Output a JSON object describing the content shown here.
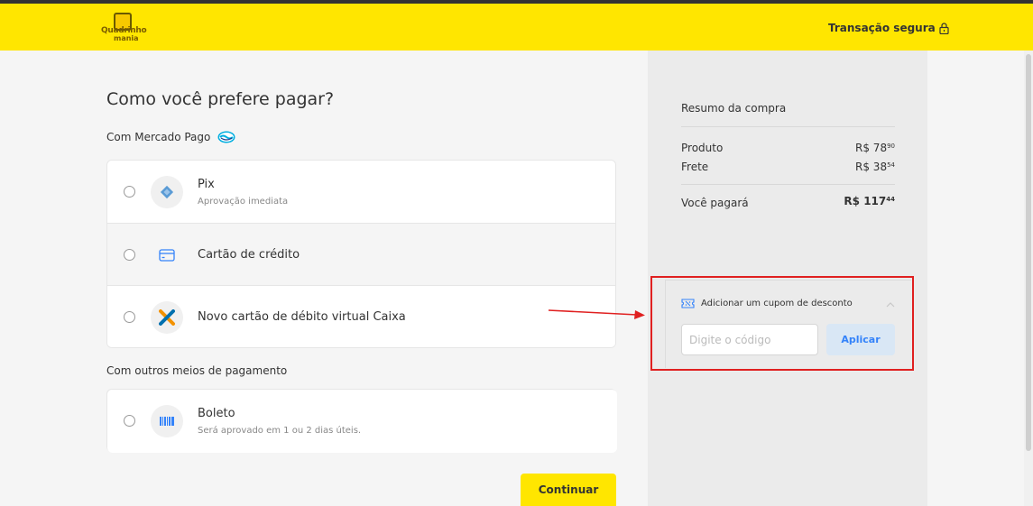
{
  "header": {
    "logo_text_1": "Quadrinho",
    "logo_text_2": "mania",
    "secure_label": "Transação segura"
  },
  "main": {
    "title": "Como você prefere pagar?",
    "mercado_pago_label": "Com Mercado Pago",
    "other_methods_label": "Com outros meios de pagamento",
    "options": [
      {
        "title": "Pix",
        "subtitle": "Aprovação imediata",
        "icon": "pix-icon"
      },
      {
        "title": "Cartão de crédito",
        "subtitle": "",
        "icon": "credit-card-icon"
      },
      {
        "title": "Novo cartão de débito virtual Caixa",
        "subtitle": "",
        "icon": "caixa-logo-icon"
      }
    ],
    "other_options": [
      {
        "title": "Boleto",
        "subtitle": "Será aprovado em 1 ou 2 dias úteis.",
        "icon": "barcode-icon"
      }
    ],
    "continue_label": "Continuar"
  },
  "summary": {
    "title": "Resumo da compra",
    "product_label": "Produto",
    "product_value": "R$ 78",
    "product_cents": "90",
    "shipping_label": "Frete",
    "shipping_value": "R$ 38",
    "shipping_cents": "54",
    "total_label": "Você pagará",
    "total_value": "R$ 117",
    "total_cents": "44"
  },
  "coupon": {
    "title": "Adicionar um cupom de desconto",
    "placeholder": "Digite o código",
    "apply_label": "Aplicar"
  },
  "colors": {
    "brand_yellow": "#ffe600",
    "accent_blue": "#3483fa",
    "annotation_red": "#e02020"
  }
}
